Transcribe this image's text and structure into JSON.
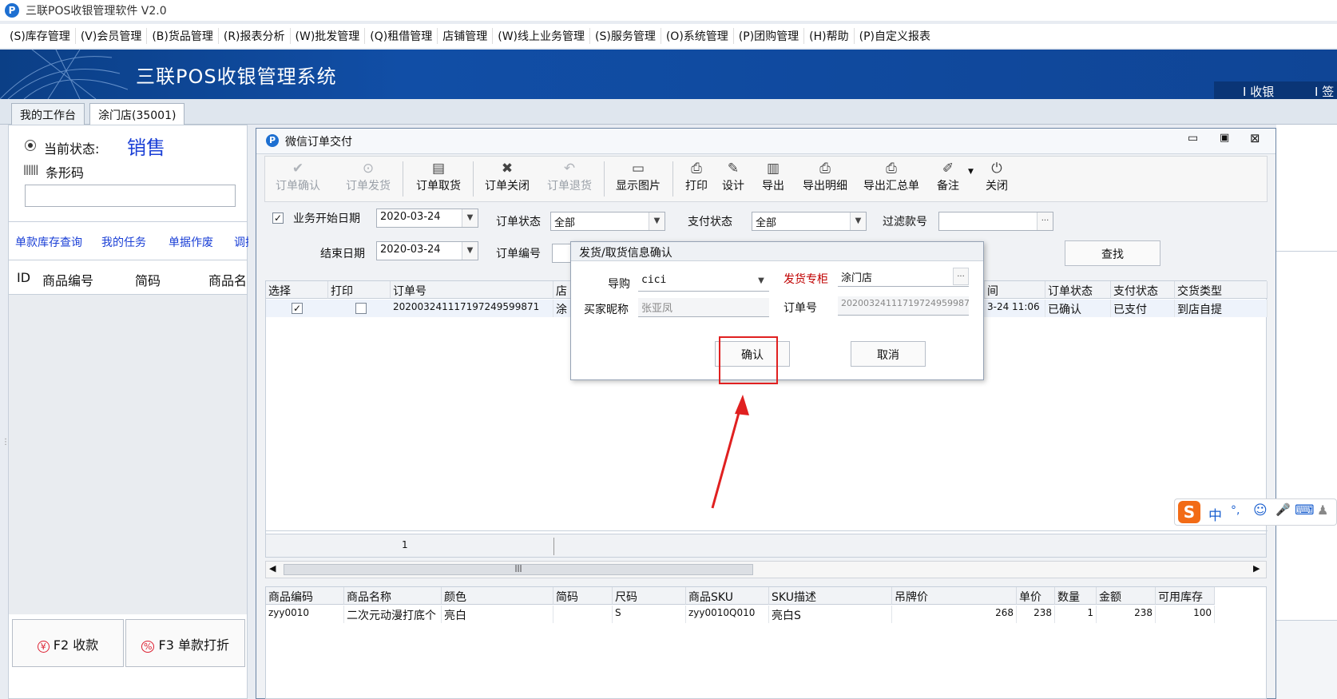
{
  "window": {
    "title": "三联POS收银管理软件 V2.0",
    "app_icon": "P"
  },
  "menu": [
    "(S)库存管理",
    "(V)会员管理",
    "(B)货品管理",
    "(R)报表分析",
    "(W)批发管理",
    "(Q)租借管理",
    "店铺管理",
    "(W)线上业务管理",
    "(S)服务管理",
    "(O)系统管理",
    "(P)团购管理",
    "(H)帮助",
    "(P)自定义报表"
  ],
  "banner": {
    "title": "三联POS收银管理系统",
    "right_items": [
      "I 收银",
      "I 签到"
    ]
  },
  "tabs": [
    "我的工作台",
    "涂门店(35001)"
  ],
  "left": {
    "status_label": "当前状态:",
    "status_value": "销售",
    "barcode_label": "条形码",
    "barcode_value": "",
    "links": [
      "单款库存查询",
      "我的任务",
      "单据作废",
      "调拨"
    ],
    "table_headers": [
      "ID",
      "商品编号",
      "简码",
      "商品名称"
    ],
    "fkeys": [
      "F2 收款",
      "F3 单款打折"
    ]
  },
  "wechat_window": {
    "title": "微信订单交付",
    "toolbar": [
      {
        "label": "订单确认",
        "icon": "check-icon",
        "glyph": "✔",
        "enabled": false
      },
      {
        "label": "订单发货",
        "icon": "ship-icon",
        "glyph": "⊙",
        "enabled": false
      },
      {
        "label": "订单取货",
        "icon": "pickup-icon",
        "glyph": "▤",
        "enabled": true
      },
      {
        "label": "订单关闭",
        "icon": "close-x-icon",
        "glyph": "✖",
        "enabled": true
      },
      {
        "label": "订单退货",
        "icon": "return-icon",
        "glyph": "↶",
        "enabled": false
      },
      {
        "label": "显示图片",
        "icon": "image-icon",
        "glyph": "▭",
        "enabled": true
      },
      {
        "label": "打印",
        "icon": "printer-icon",
        "glyph": "⎙",
        "enabled": true
      },
      {
        "label": "设计",
        "icon": "design-icon",
        "glyph": "✎",
        "enabled": true
      },
      {
        "label": "导出",
        "icon": "export-icon",
        "glyph": "▥",
        "enabled": true
      },
      {
        "label": "导出明细",
        "icon": "export-detail-icon",
        "glyph": "⎙",
        "enabled": true
      },
      {
        "label": "导出汇总单",
        "icon": "export-summary-icon",
        "glyph": "⎙",
        "enabled": true
      },
      {
        "label": "备注",
        "icon": "note-icon",
        "glyph": "✐",
        "enabled": true
      },
      {
        "label": "关闭",
        "icon": "power-icon",
        "glyph": "⏻",
        "enabled": true
      }
    ],
    "filters": {
      "start_date_label": "业务开始日期",
      "start_date": "2020-03-24",
      "end_date_label": "结束日期",
      "end_date": "2020-03-24",
      "order_status_label": "订单状态",
      "order_status": "全部",
      "pay_status_label": "支付状态",
      "pay_status": "全部",
      "filter_sku_label": "过滤款号",
      "filter_sku": "",
      "order_no_label": "订单编号",
      "search_btn": "查找"
    },
    "orders": {
      "headers": [
        "选择",
        "打印",
        "订单号",
        "店",
        "间",
        "订单状态",
        "支付状态",
        "交货类型"
      ],
      "rows": [
        {
          "order_no": "20200324111719724959987​1",
          "shop": "涂",
          "time": "3-24 11:06",
          "status": "已确认",
          "pay": "已支付",
          "delivery": "到店自提"
        }
      ],
      "footer_count": "1"
    },
    "details": {
      "headers": [
        "商品编码",
        "商品名称",
        "颜色",
        "简码",
        "尺码",
        "商品SKU",
        "SKU描述",
        "吊牌价",
        "单价",
        "数量",
        "金额",
        "可用库存"
      ],
      "rows": [
        [
          "zyy0010",
          "二次元动漫打底个",
          "亮白",
          "",
          "S",
          "zyy0010Q010",
          "亮白S",
          "268",
          "238",
          "1",
          "238",
          "100"
        ]
      ]
    }
  },
  "dialog": {
    "title": "发货/取货信息确认",
    "guide_label": "导购",
    "guide_value": "cici",
    "cabinet_label": "发货专柜",
    "cabinet_value": "涂门店",
    "buyer_label": "买家昵称",
    "buyer_value": "张亚凤",
    "order_label": "订单号",
    "order_value": "20200324111719724959987",
    "confirm": "确认",
    "cancel": "取消"
  },
  "ime": [
    "中",
    "°,",
    "☺",
    "🎤",
    "⌨"
  ],
  "colors": {
    "accent": "#1a3fd6",
    "highlight": "#e02020",
    "label_red": "#c00000",
    "banner": "#0f4596"
  }
}
